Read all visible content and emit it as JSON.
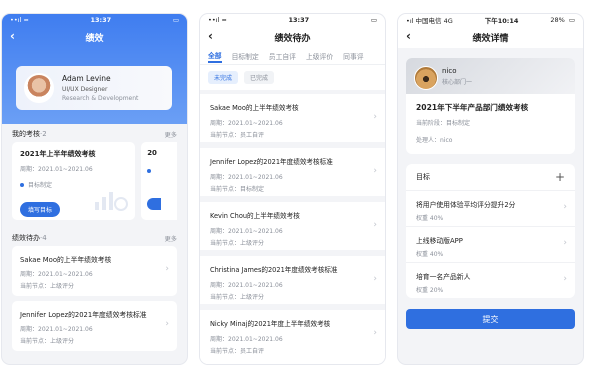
{
  "phone1": {
    "status": {
      "carrier": "••ıl ≈",
      "time": "13:37"
    },
    "nav_title": "绩效",
    "profile": {
      "name": "Adam Levine",
      "role": "UI/UX Designer",
      "dept": "Research & Development"
    },
    "my_assess": {
      "title": "我的考核",
      "count": "·2",
      "more": "更多"
    },
    "assess_cards": [
      {
        "title": "2021年上半年绩效考核",
        "period": "周期：2021.01~2021.06",
        "stage": "目标制定",
        "button": "填写目标"
      },
      {
        "title": "20"
      }
    ],
    "todo": {
      "title": "绩效待办",
      "count": "·4",
      "more": "更多"
    },
    "todo_items": [
      {
        "title": "Sakae Moo的上半年绩效考核",
        "period": "周期：2021.01~2021.06",
        "node": "当前节点：上级评分"
      },
      {
        "title": "Jennifer Lopez的2021年度绩效考核标准",
        "period": "周期：2021.01~2021.06",
        "node": "当前节点：上级评分"
      }
    ]
  },
  "phone2": {
    "status": {
      "carrier": "••ıl ≈",
      "time": "13:37"
    },
    "nav_title": "绩效待办",
    "tabs": [
      "全部",
      "目标制定",
      "员工自评",
      "上级评价",
      "同事评"
    ],
    "filters": [
      "未完成",
      "已完成"
    ],
    "items": [
      {
        "title": "Sakae Moo的上半年绩效考核",
        "period": "周期：2021.01~2021.06",
        "node": "当前节点：员工自评"
      },
      {
        "title": "Jennifer Lopez的2021年度绩效考核标准",
        "period": "周期：2021.01~2021.06",
        "node": "当前节点：目标制定"
      },
      {
        "title": "Kevin Chou的上半年绩效考核",
        "period": "周期：2021.01~2021.06",
        "node": "当前节点：上级评分"
      },
      {
        "title": "Christina James的2021年度绩效考核标准",
        "period": "周期：2021.01~2021.06",
        "node": "当前节点：上级评分"
      },
      {
        "title": "Nicky Minaj的2021年度上半年绩效考核",
        "period": "周期：2021.01~2021.06",
        "node": "当前节点：员工自评"
      }
    ]
  },
  "phone3": {
    "status": {
      "carrier": "•ıl 中国电信  4G",
      "time": "下午10:14",
      "battery": "28%"
    },
    "nav_title": "绩效详情",
    "user": {
      "name": "nico",
      "dept": "核心部门一"
    },
    "plan_title": "2021年下半年产品部门绩效考核",
    "stage": "当前阶段：目标制定",
    "handler": "处理人：nico",
    "goals_title": "目标",
    "add": "+",
    "goals": [
      {
        "title": "将用户使用体验平均评分提升2分",
        "weight": "权重 40%"
      },
      {
        "title": "上线移动版APP",
        "weight": "权重 40%"
      },
      {
        "title": "培育一名产品新人",
        "weight": "权重 20%"
      }
    ],
    "submit": "提交"
  }
}
